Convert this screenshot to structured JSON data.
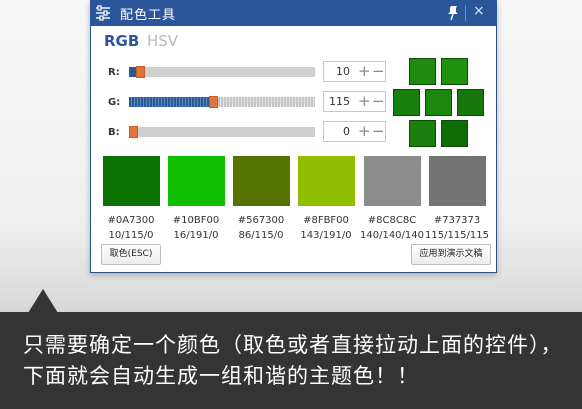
{
  "window": {
    "title": "配色工具",
    "icons": {
      "app": "sliders-icon",
      "pin": "pin-icon",
      "close": "close-icon"
    },
    "close_glyph": "×"
  },
  "tabs": [
    {
      "label": "RGB",
      "active": true
    },
    {
      "label": "HSV",
      "active": false
    }
  ],
  "channels": [
    {
      "label": "R:",
      "value": "10",
      "fraction": 0.039
    },
    {
      "label": "G:",
      "value": "115",
      "fraction": 0.451
    },
    {
      "label": "B:",
      "value": "0",
      "fraction": 0.0
    }
  ],
  "spinner": {
    "plus": "+",
    "minus": "−"
  },
  "palette_grid": [
    "#1f8a0f",
    "#20910f",
    "#17800b",
    "#1c870d",
    "#16770a",
    "#1a7f0c",
    "#0f6c07",
    "#13700a"
  ],
  "swatches": [
    {
      "hex": "#0A7300",
      "rgb": "10/115/0",
      "color": "#0A7300"
    },
    {
      "hex": "#10BF00",
      "rgb": "16/191/0",
      "color": "#10BF00"
    },
    {
      "hex": "#567300",
      "rgb": "86/115/0",
      "color": "#567300"
    },
    {
      "hex": "#8FBF00",
      "rgb": "143/191/0",
      "color": "#8FBF00"
    },
    {
      "hex": "#8C8C8C",
      "rgb": "140/140/140",
      "color": "#8C8C8C"
    },
    {
      "hex": "#737373",
      "rgb": "115/115/115",
      "color": "#737373"
    }
  ],
  "buttons": {
    "pick": "取色(ESC)",
    "apply": "应用到演示文稿"
  },
  "caption": "只需要确定一个颜色（取色或者直接拉动上面的控件），下面就会自动生成一组和谐的主题色！！",
  "colors": {
    "accent": "#2b579a",
    "thumb": "#e0763a",
    "caption_bg": "#343434"
  }
}
